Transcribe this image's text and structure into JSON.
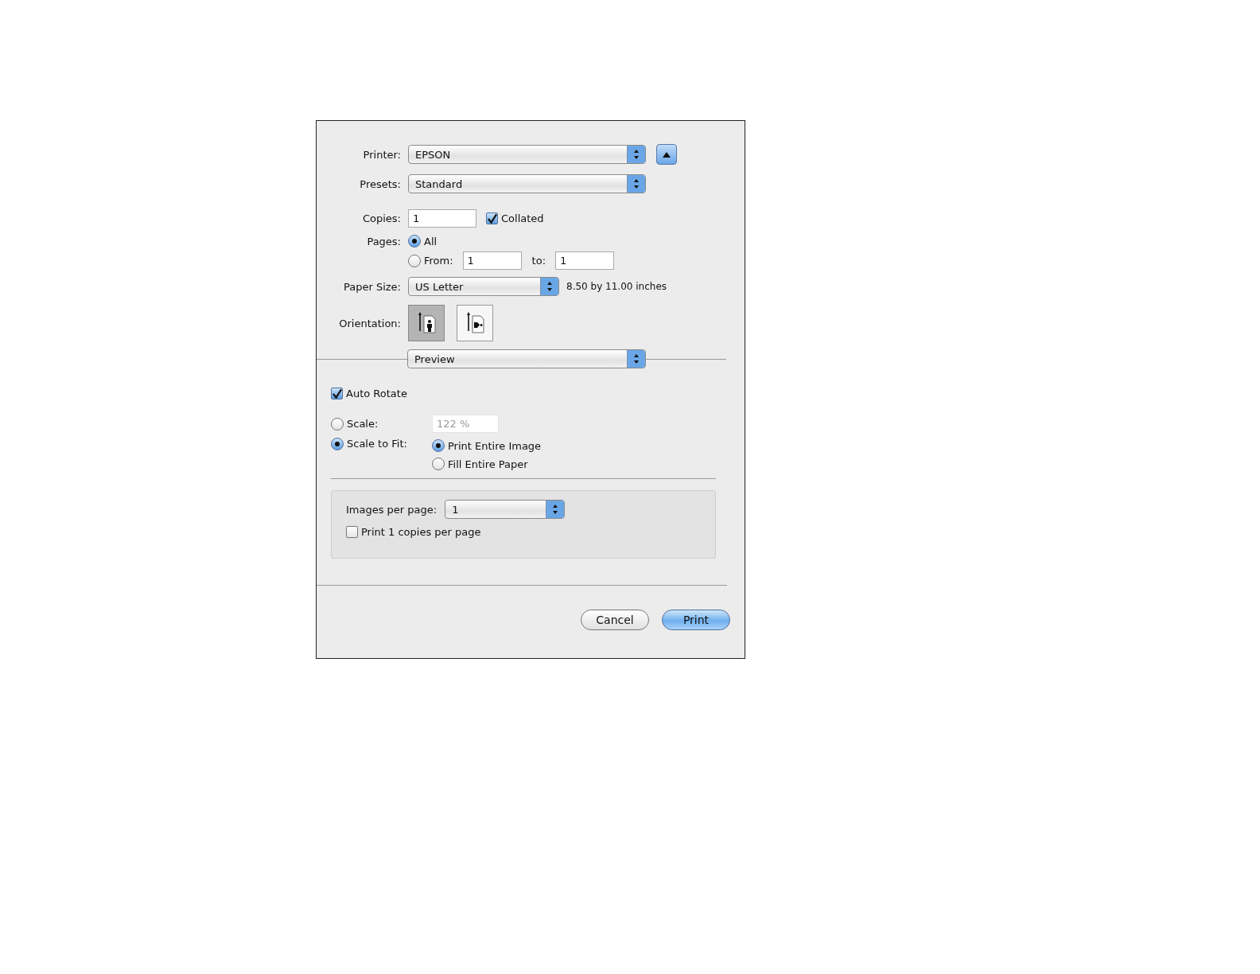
{
  "printer": {
    "label": "Printer:",
    "value": "EPSON"
  },
  "presets": {
    "label": "Presets:",
    "value": "Standard"
  },
  "copies": {
    "label": "Copies:",
    "value": "1",
    "collated": {
      "label": "Collated",
      "checked": true
    }
  },
  "pages": {
    "label": "Pages:",
    "all": {
      "label": "All",
      "selected": true
    },
    "range": {
      "label": "From:",
      "selected": false,
      "from": "1",
      "to_label": "to:",
      "to": "1"
    }
  },
  "paper_size": {
    "label": "Paper Size:",
    "value": "US Letter",
    "dimensions": "8.50 by 11.00 inches"
  },
  "orientation": {
    "label": "Orientation:",
    "options": [
      {
        "kind": "portrait",
        "selected": true
      },
      {
        "kind": "landscape",
        "selected": false
      }
    ]
  },
  "section_menu": {
    "value": "Preview"
  },
  "auto_rotate": {
    "label": "Auto Rotate",
    "checked": true
  },
  "scale": {
    "label": "Scale:",
    "selected": false,
    "value": "122 %",
    "disabled": true
  },
  "scale_to_fit": {
    "label": "Scale to Fit:",
    "selected": true,
    "options": [
      {
        "label": "Print Entire Image",
        "selected": true
      },
      {
        "label": "Fill Entire Paper",
        "selected": false
      }
    ]
  },
  "layout_panel": {
    "images_label": "Images per page:",
    "images_value": "1",
    "copies_per_page": {
      "label": "Print 1 copies per page",
      "checked": false
    }
  },
  "buttons": [
    {
      "label": "Cancel",
      "default": false
    },
    {
      "label": "Print",
      "default": true
    }
  ]
}
